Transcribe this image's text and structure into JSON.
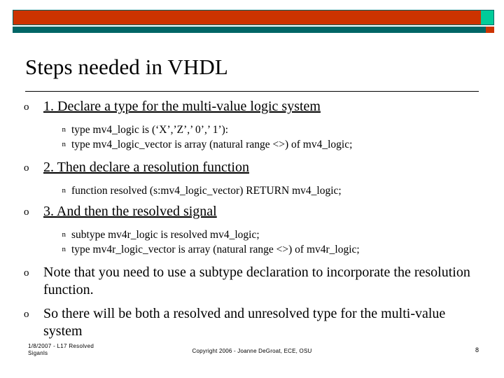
{
  "slide": {
    "title": "Steps needed in VHDL",
    "bullet_l1_glyph": "o",
    "bullet_l2_glyph": "n",
    "items": [
      {
        "level": 1,
        "underline": true,
        "text": "1. Declare a type for the multi-value logic system"
      },
      {
        "level": 2,
        "text": "type mv4_logic is (‘X’,’Z’,’ 0’,’ 1’):"
      },
      {
        "level": 2,
        "text": "type mv4_logic_vector is array (natural range <>) of mv4_logic;"
      },
      {
        "level": 1,
        "underline": true,
        "text": "2. Then declare a resolution function"
      },
      {
        "level": 2,
        "text": "function resolved (s:mv4_logic_vector) RETURN   mv4_logic;"
      },
      {
        "level": 1,
        "underline": true,
        "text": "3. And then the resolved signal"
      },
      {
        "level": 2,
        "text": "subtype mv4r_logic is resolved mv4_logic;"
      },
      {
        "level": 2,
        "text": "type mv4r_logic_vector is array (natural range <>) of mv4r_logic;"
      },
      {
        "level": 1,
        "underline": false,
        "text": "Note that you need to use a subtype declaration to incorporate the resolution function."
      },
      {
        "level": 1,
        "underline": false,
        "text": "So there will be both a resolved and unresolved type for the multi-value system"
      }
    ]
  },
  "footer": {
    "left_line1": "1/8/2007 - L17 Resolved",
    "left_line2": "Siganls",
    "center": "Copyright 2006 - Joanne DeGroat, ECE, OSU",
    "page_number": "8"
  },
  "colors": {
    "top_bar": "#cc3300",
    "top_bar_accent": "#00cc99",
    "under_bar": "#006666",
    "under_bar_accent": "#cc3300",
    "text": "#000000",
    "background": "#ffffff"
  }
}
